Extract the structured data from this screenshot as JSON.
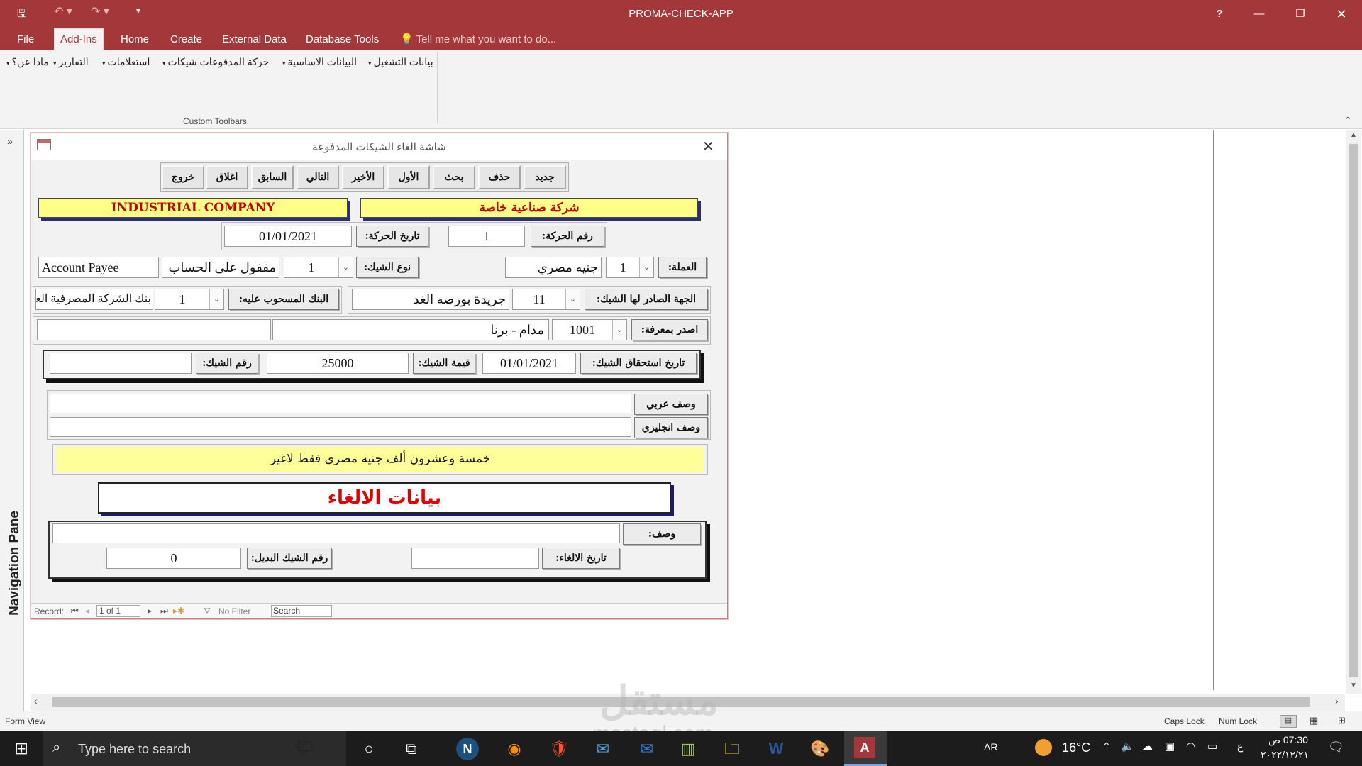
{
  "app": {
    "title": "PROMA-CHECK-APP",
    "help": "?"
  },
  "tabs": [
    "File",
    "Add-Ins",
    "Home",
    "Create",
    "External Data",
    "Database Tools"
  ],
  "tell_me": "Tell me what you want to do...",
  "ribbon": {
    "menus": [
      "بيانات التشغيل",
      "البيانات الاساسية",
      "حركة المدفوعات شيكات",
      "استعلامات",
      "التقارير",
      "ماذا عن؟"
    ],
    "group_label": "Custom Toolbars"
  },
  "nav": {
    "label": "Navigation Pane"
  },
  "form": {
    "title": "شاشة الغاء الشيكات المدفوعة",
    "buttons": [
      "جديد",
      "حذف",
      "بحث",
      "الأول",
      "الأخير",
      "التالي",
      "السابق",
      "اغلاق",
      "خروج"
    ],
    "company_ar": "شركة صناعية خاصة",
    "company_en": "INDUSTRIAL COMPANY",
    "txn_no_label": "رقم الحركة:",
    "txn_no": "1",
    "txn_date_label": "تاريخ الحركة:",
    "txn_date": "01/01/2021",
    "currency_label": "العملة:",
    "currency_code": "1",
    "currency_name": "جنيه مصري",
    "check_type_label": "نوع الشيك:",
    "check_type_code": "1",
    "check_type_name": "مقفول على الحساب",
    "check_type_en": "Account Payee",
    "payee_label": "الجهة الصادر لها الشيك:",
    "payee_code": "11",
    "payee_name": "جريدة بورصه الغد",
    "bank_label": "البنك المسحوب عليه:",
    "bank_code": "1",
    "bank_name": "بنك الشركة المصرفية العر",
    "issued_by_label": "اصدر بمعرفة:",
    "issued_by_code": "1001",
    "issued_by_name": "مدام - برنا",
    "issued_by_extra": "",
    "due_date_label": "تاريخ استحقاق الشيك:",
    "due_date": "01/01/2021",
    "amount_label": "قيمة الشيك:",
    "amount": "25000",
    "check_no_label": "رقم الشيك:",
    "check_no": "",
    "desc_ar_label": "وصف عربي",
    "desc_ar": "",
    "desc_en_label": "وصف انجليزي",
    "desc_en": "",
    "amount_words": "خمسة وعشرون ألف جنيه مصري  فقط لاغير",
    "cancel_header": "بيانات الالغاء",
    "cancel_desc_label": "وصف:",
    "cancel_desc": "",
    "cancel_date_label": "تاريخ الالغاء:",
    "cancel_date": "",
    "alt_check_label": "رقم الشيك البديل:",
    "alt_check": "0"
  },
  "record_nav": {
    "label": "Record:",
    "position": "1 of 1",
    "filter": "No Filter",
    "search": "Search"
  },
  "status": {
    "left": "Form View",
    "caps": "Caps Lock",
    "num": "Num Lock"
  },
  "taskbar": {
    "search_placeholder": "Type here to search",
    "lang": "AR",
    "temp": "16°C",
    "time": "07:30 ص",
    "date": "٢٠٢٢/١٢/٢١",
    "ime": "ع"
  },
  "watermark": {
    "ar": "مستقل",
    "en": "mostaql.com"
  }
}
